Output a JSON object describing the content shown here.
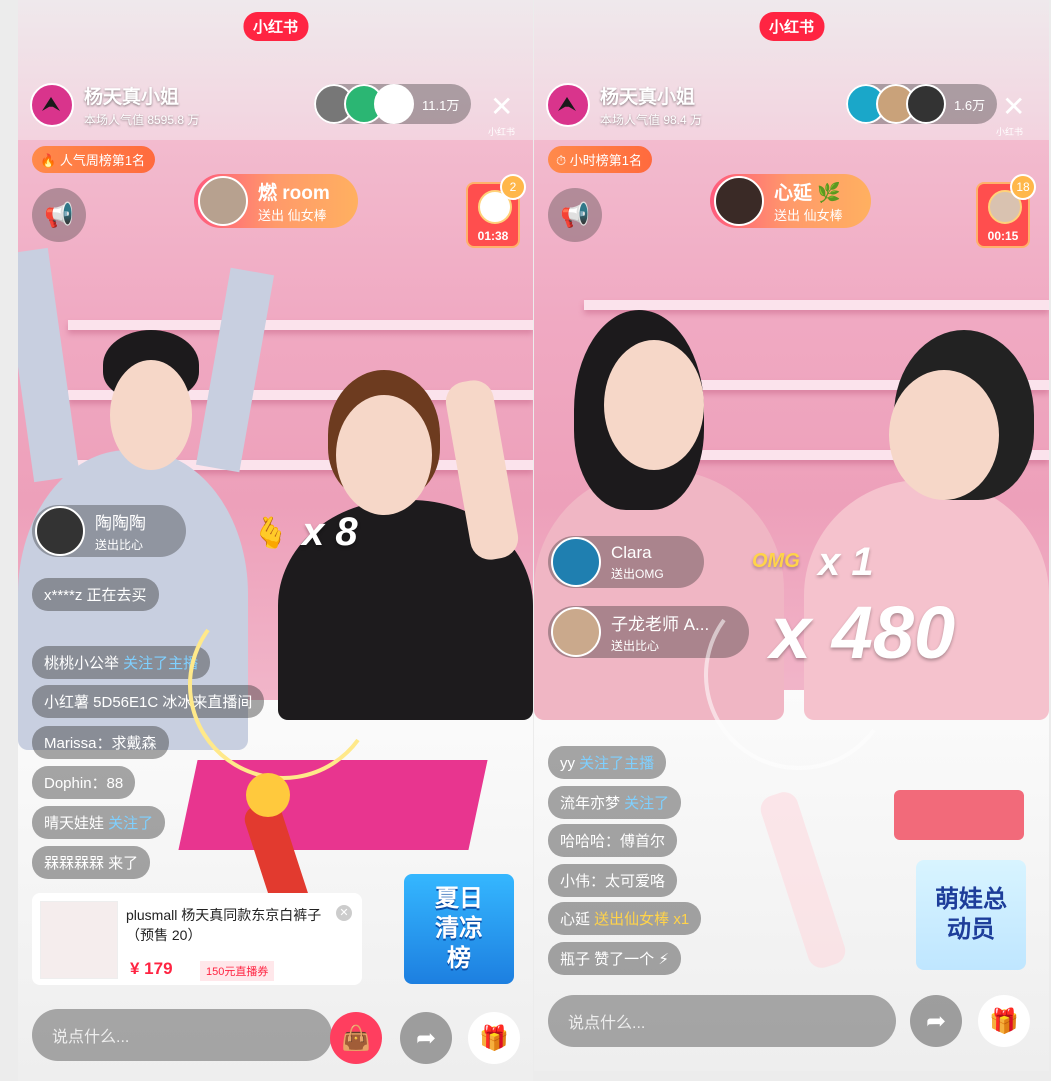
{
  "app_logo": "小红书",
  "left": {
    "host_name": "杨天真小姐",
    "host_popularity": "本场人气值 8595.8 万",
    "viewer_count": "11.1万",
    "close_sub": "小红书",
    "rank_badge": "人气周榜第1名",
    "gift_sender": "燃 room",
    "gift_text": "送出 仙女棒",
    "red_packet_timer": "01:38",
    "red_packet_badge": "2",
    "combo": "x 8",
    "entry_name": "陶陶陶",
    "entry_sub": "送出比心",
    "comments": [
      {
        "user": "x****z",
        "text": " 正在去买"
      },
      {
        "user": "桃桃小公举",
        "text": " 关注了主播"
      },
      {
        "user": "小红薯 5D56E1C",
        "text": " 冰冰来直播间"
      },
      {
        "user": "Marissa：",
        "text": "求戴森"
      },
      {
        "user": "Dophin",
        "text": "：88"
      },
      {
        "user": "晴天娃娃",
        "text": " 关注了"
      },
      {
        "user": "",
        "text": "槑槑槑槑 来了"
      }
    ],
    "product": {
      "title": "plusmall 杨天真同款东京白裤子（预售 20）",
      "price": "¥ 179",
      "coupon": "150元直播券"
    },
    "promo": "夏日清凉榜",
    "input_placeholder": "说点什么..."
  },
  "right": {
    "host_name": "杨天真小姐",
    "host_popularity": "本场人气值 98.4 万",
    "viewer_count": "1.6万",
    "close_sub": "小红书",
    "rank_badge": "小时榜第1名",
    "gift_sender": "心延",
    "gift_text": "送出 仙女棒",
    "red_packet_timer": "00:15",
    "red_packet_badge": "18",
    "entry1_name": "Clara",
    "entry1_sub": "送出OMG",
    "entry2_name": "子龙老师 A...",
    "entry2_sub": "送出比心",
    "combo_small": "x 1",
    "combo_big": "x 480",
    "omg_label": "OMG",
    "comments": [
      {
        "user": "yy",
        "text": " 关注了主播"
      },
      {
        "user": "流年亦梦",
        "text": " 关注了"
      },
      {
        "user": "哈哈哈：",
        "text": "傅首尔"
      },
      {
        "user": "小伟：",
        "text": "太可爱咯"
      },
      {
        "user": "心延",
        "text": " 送出仙女棒 x1"
      },
      {
        "user": "瓶子 ",
        "text": "赞了一个"
      }
    ],
    "promo": "萌娃总动员",
    "input_placeholder": "说点什么..."
  },
  "colors": {
    "brand": "#ff2442",
    "wall": "#f0a9c2",
    "rank": "#ff7a45"
  }
}
